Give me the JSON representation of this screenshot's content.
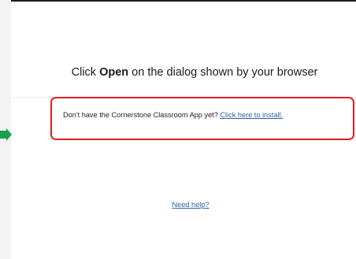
{
  "dialog": {
    "headline_prefix": "Click ",
    "headline_bold": "Open",
    "headline_suffix": " on the dialog shown by your browser",
    "install_prompt": "Don't have the Cornerstone Classroom App yet? ",
    "install_link": "Click here to install.",
    "help_link": "Need help?"
  },
  "annotations": {
    "highlight_color": "#e01f1f",
    "arrow_color": "#17a24a",
    "arrow_icon": "arrow-right-icon"
  },
  "colors": {
    "link": "#2f5fa6",
    "text": "#1a1a1a"
  }
}
